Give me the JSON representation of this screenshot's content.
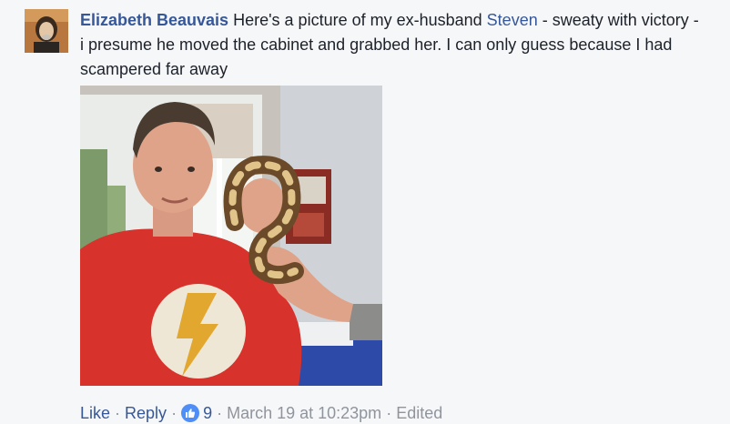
{
  "comment": {
    "author": "Elizabeth Beauvais",
    "text_before": "Here's a picture of my ex-husband ",
    "mention": "Steven",
    "text_after": " - sweaty with victory - i presume he moved the cabinet and grabbed her. I can only guess because I had scampered far away",
    "actions": {
      "like_label": "Like",
      "reply_label": "Reply",
      "reaction_count": "9",
      "timestamp": "March 19 at 10:23pm",
      "edited_label": "Edited",
      "separator": "·"
    },
    "icons": {
      "reaction": "like-thumbs-up-icon"
    },
    "colors": {
      "link": "#365899",
      "meta": "#90949c",
      "text": "#1d2129",
      "like_badge": "#4f8ef7"
    }
  }
}
